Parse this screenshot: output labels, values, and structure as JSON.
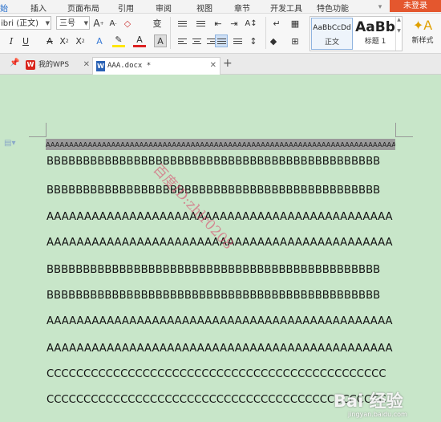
{
  "menu": {
    "items": [
      "始",
      "插入",
      "页面布局",
      "引用",
      "审阅",
      "视图",
      "章节",
      "开发工具",
      "特色功能"
    ],
    "login": "未登录"
  },
  "ribbon": {
    "font_name": "ibri (正文)",
    "font_size": "三号",
    "styles": [
      {
        "preview": "AaBbCcDd",
        "name": "正文"
      },
      {
        "preview": "AaBb",
        "name": "标题 1"
      }
    ],
    "new_style": "新样式"
  },
  "tabs": [
    {
      "label": "我的WPS"
    },
    {
      "label": "AAA.docx *"
    }
  ],
  "document": {
    "lines": [
      "AAAAAAAAAAAAAAAAAAAAAAAAAAAAAAAAAAAAAAAAAAAAAAAAAAAAAAAAAAAAAAAAAAAAAAAAAAAAAAAAAAAAAAAAAAAAAAA",
      "BBBBBBBBBBBBBBBBBBBBBBBBBBBBBBBBBBBBBBBBBBBBBB",
      "BBBBBBBBBBBBBBBBBBBBBBBBBBBBBBBBBBBBBBBBBBBBBB",
      "AAAAAAAAAAAAAAAAAAAAAAAAAAAAAAAAAAAAAAAAAAAAAA",
      "AAAAAAAAAAAAAAAAAAAAAAAAAAAAAAAAAAAAAAAAAAAAAA",
      "BBBBBBBBBBBBBBBBBBBBBBBBBBBBBBBBBBBBBBBBBBBBBB",
      "BBBBBBBBBBBBBBBBBBBBBBBBBBBBBBBBBBBBBBBBBBBBBB",
      "AAAAAAAAAAAAAAAAAAAAAAAAAAAAAAAAAAAAAAAAAAAAAA",
      "AAAAAAAAAAAAAAAAAAAAAAAAAAAAAAAAAAAAAAAAAAAAAA",
      "CCCCCCCCCCCCCCCCCCCCCCCCCCCCCCCCCCCCCCCCCCCCCC",
      "CCCCCCCCCCCCCCCCCCCCCCCCCCCCCCCCCCCCCCCCCCCCCC"
    ],
    "watermark": "百度ID:zhlr0208"
  },
  "corner_watermark": {
    "big": "Bai 经验",
    "small": "jingyan.baidu.com"
  },
  "colors": {
    "page_background": "#c8e6c9",
    "login_button": "#e4572e",
    "selected_highlight": "#9a9a9a"
  }
}
